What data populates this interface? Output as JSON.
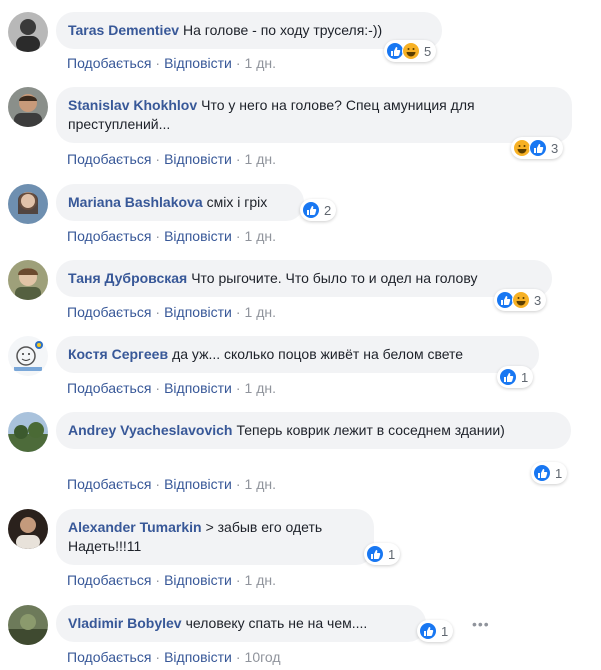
{
  "colors": {
    "link": "#385898",
    "muted": "#90949c",
    "bubble": "#f2f3f5",
    "like_blue": "#1877f2",
    "haha_yellow": "#f7b125"
  },
  "common": {
    "like_label": "Подобається",
    "reply_label": "Відповісти",
    "separator": "·"
  },
  "comments": [
    {
      "author": "Taras Dementiev",
      "text": "На голове - по ходу труселя:-))",
      "time": "1 дн.",
      "reaction_count": "5",
      "reactions": [
        "like-icon",
        "haha-icon"
      ]
    },
    {
      "author": "Stanislav Khokhlov",
      "text": "Что у него на голове? Спец амуниция для преступлений...",
      "time": "1 дн.",
      "reaction_count": "3",
      "reactions": [
        "haha-icon",
        "like-icon"
      ]
    },
    {
      "author": "Mariana Bashlakova",
      "text": "сміх і гріх",
      "time": "1 дн.",
      "reaction_count": "2",
      "reactions": [
        "like-icon"
      ]
    },
    {
      "author": "Таня Дубровская",
      "text": "Что рыгочите. Что было то и одел на голову",
      "time": "1 дн.",
      "reaction_count": "3",
      "reactions": [
        "like-icon",
        "haha-icon"
      ]
    },
    {
      "author": "Костя Сергеев",
      "text": "да уж... сколько поцов живёт на белом свете",
      "time": "1 дн.",
      "reaction_count": "1",
      "reactions": [
        "like-icon"
      ]
    },
    {
      "author": "Andrey Vyacheslavovich",
      "text": "Теперь коврик лежит в соседнем здании)",
      "time": "1 дн.",
      "reaction_count": "1",
      "reactions": [
        "like-icon"
      ]
    },
    {
      "author": "Alexander Tumarkin",
      "text": "> забыв его одеть Надеть!!!11",
      "time": "1 дн.",
      "reaction_count": "1",
      "reactions": [
        "like-icon"
      ]
    },
    {
      "author": "Vladimir Bobylev",
      "text": "человеку спать не на чем....",
      "time": "10год",
      "reaction_count": "1",
      "reactions": [
        "like-icon"
      ]
    }
  ],
  "more_icon": "more-options-icon"
}
